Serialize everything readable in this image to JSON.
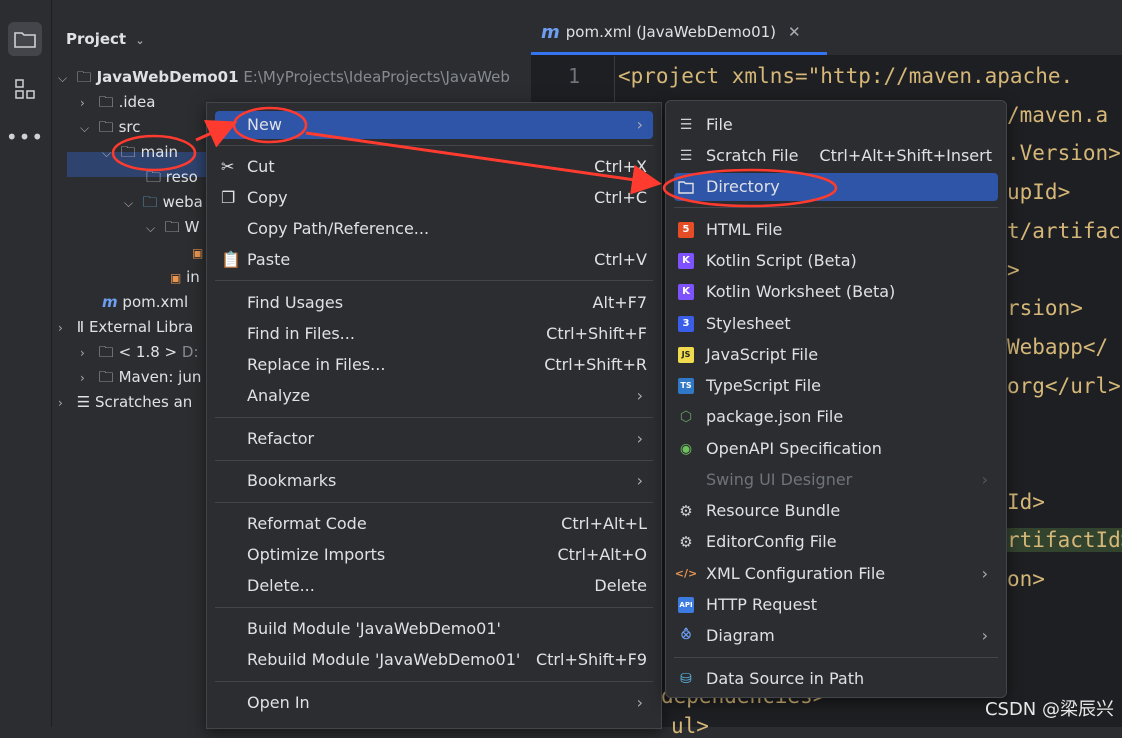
{
  "project_panel": {
    "header": "Project",
    "tree": [
      {
        "label": "JavaWebDemo01",
        "path": "E:\\MyProjects\\IdeaProjects\\JavaWeb",
        "bold": true
      },
      {
        "label": ".idea"
      },
      {
        "label": "src"
      },
      {
        "label": "main"
      },
      {
        "label": "reso"
      },
      {
        "label": "weba"
      },
      {
        "label": "W"
      },
      {
        "label": "in"
      },
      {
        "label": "pom.xml"
      },
      {
        "label": "External Libra"
      },
      {
        "label": "< 1.8 >",
        "path": "D:"
      },
      {
        "label": "Maven: jun"
      },
      {
        "label": "Scratches an"
      }
    ]
  },
  "editor": {
    "tab_label": "pom.xml (JavaWebDemo01)",
    "line_number": "1",
    "code_lines": [
      "<project xmlns=\"http://maven.apache.",
      "/maven.a",
      ".Version>",
      "upId>",
      "t/artifac",
      ">",
      "rsion>",
      "Webapp</",
      "org</url>",
      "Id>",
      "rtifactId>",
      "on>",
      "dependencies>",
      "ul>"
    ]
  },
  "context_menu": {
    "items": [
      {
        "label": "New",
        "shortcut": "",
        "submenu": true
      },
      {
        "label": "Cut",
        "shortcut": "Ctrl+X"
      },
      {
        "label": "Copy",
        "shortcut": "Ctrl+C"
      },
      {
        "label": "Copy Path/Reference...",
        "shortcut": ""
      },
      {
        "label": "Paste",
        "shortcut": "Ctrl+V"
      },
      {
        "label": "Find Usages",
        "shortcut": "Alt+F7"
      },
      {
        "label": "Find in Files...",
        "shortcut": "Ctrl+Shift+F"
      },
      {
        "label": "Replace in Files...",
        "shortcut": "Ctrl+Shift+R"
      },
      {
        "label": "Analyze",
        "shortcut": "",
        "submenu": true
      },
      {
        "label": "Refactor",
        "shortcut": "",
        "submenu": true
      },
      {
        "label": "Bookmarks",
        "shortcut": "",
        "submenu": true
      },
      {
        "label": "Reformat Code",
        "shortcut": "Ctrl+Alt+L"
      },
      {
        "label": "Optimize Imports",
        "shortcut": "Ctrl+Alt+O"
      },
      {
        "label": "Delete...",
        "shortcut": "Delete"
      },
      {
        "label": "Build Module 'JavaWebDemo01'",
        "shortcut": ""
      },
      {
        "label": "Rebuild Module 'JavaWebDemo01'",
        "shortcut": "Ctrl+Shift+F9"
      },
      {
        "label": "Open In",
        "shortcut": "",
        "submenu": true
      }
    ]
  },
  "new_submenu": {
    "items": [
      {
        "label": "File",
        "shortcut": ""
      },
      {
        "label": "Scratch File",
        "shortcut": "Ctrl+Alt+Shift+Insert"
      },
      {
        "label": "Directory",
        "shortcut": ""
      },
      {
        "label": "HTML File",
        "shortcut": "",
        "badge": "5"
      },
      {
        "label": "Kotlin Script (Beta)",
        "shortcut": ""
      },
      {
        "label": "Kotlin Worksheet (Beta)",
        "shortcut": ""
      },
      {
        "label": "Stylesheet",
        "shortcut": "",
        "badge": "3"
      },
      {
        "label": "JavaScript File",
        "shortcut": "",
        "badge": "JS"
      },
      {
        "label": "TypeScript File",
        "shortcut": "",
        "badge": "TS"
      },
      {
        "label": "package.json File",
        "shortcut": ""
      },
      {
        "label": "OpenAPI Specification",
        "shortcut": ""
      },
      {
        "label": "Swing UI Designer",
        "shortcut": "",
        "disabled": true
      },
      {
        "label": "Resource Bundle",
        "shortcut": ""
      },
      {
        "label": "EditorConfig File",
        "shortcut": ""
      },
      {
        "label": "XML Configuration File",
        "shortcut": ""
      },
      {
        "label": "HTTP Request",
        "shortcut": "",
        "badge": "API"
      },
      {
        "label": "Diagram",
        "shortcut": ""
      },
      {
        "label": "Data Source in Path",
        "shortcut": ""
      }
    ]
  },
  "watermark": "CSDN @梁辰兴"
}
